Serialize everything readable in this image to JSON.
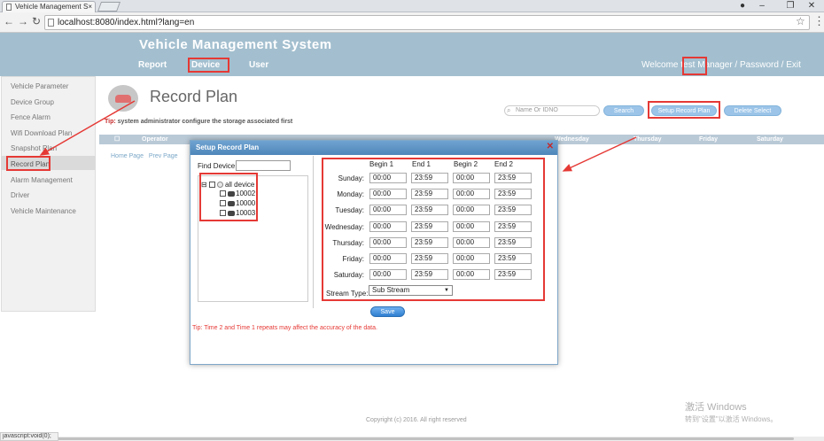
{
  "browser": {
    "tab_title": "Vehicle Management S",
    "url": "localhost:8080/index.html?lang=en"
  },
  "header": {
    "app_title": "Vehicle Management System",
    "nav": [
      "Report",
      "Device",
      "User"
    ],
    "welcome": "Welcome",
    "user": "test",
    "links": "Manager /  Password /  Exit"
  },
  "sidebar": {
    "items": [
      "Vehicle Parameter",
      "Device Group",
      "Fence Alarm",
      "Wifi Download Plan",
      "Snapshot Plan",
      "Record Plan",
      "Alarm Management",
      "Driver",
      "Vehicle Maintenance"
    ],
    "active": "Record Plan"
  },
  "main": {
    "page_title": "Record Plan",
    "tip_label": "Tip:",
    "tip": " system administrator configure the storage associated first",
    "search_placeholder": "Name Or IDNO",
    "search_btn": "Search",
    "setup_btn": "Setup Record Plan",
    "delete_btn": "Delete Select",
    "table_headers": [
      "Operator",
      "Wednesday",
      "Thursday",
      "Friday",
      "Saturday"
    ],
    "pager": [
      "Home Page",
      "Prev Page"
    ],
    "copyright": "Copyright (c) 2016. All right reserved"
  },
  "dialog": {
    "title": "Setup Record Plan",
    "find_label": "Find Device:",
    "tree": {
      "root": "all device",
      "devices": [
        "10002",
        "10000",
        "10003"
      ]
    },
    "columns": [
      "Begin 1",
      "End 1",
      "Begin 2",
      "End 2"
    ],
    "rows": [
      {
        "day": "Sunday:",
        "b1": "00:00",
        "e1": "23:59",
        "b2": "00:00",
        "e2": "23:59"
      },
      {
        "day": "Monday:",
        "b1": "00:00",
        "e1": "23:59",
        "b2": "00:00",
        "e2": "23:59"
      },
      {
        "day": "Tuesday:",
        "b1": "00:00",
        "e1": "23:59",
        "b2": "00:00",
        "e2": "23:59"
      },
      {
        "day": "Wednesday:",
        "b1": "00:00",
        "e1": "23:59",
        "b2": "00:00",
        "e2": "23:59"
      },
      {
        "day": "Thursday:",
        "b1": "00:00",
        "e1": "23:59",
        "b2": "00:00",
        "e2": "23:59"
      },
      {
        "day": "Friday:",
        "b1": "00:00",
        "e1": "23:59",
        "b2": "00:00",
        "e2": "23:59"
      },
      {
        "day": "Saturday:",
        "b1": "00:00",
        "e1": "23:59",
        "b2": "00:00",
        "e2": "23:59"
      }
    ],
    "stream_label": "Stream Type:",
    "stream_value": "Sub Stream",
    "save": "Save",
    "tip": "Tip: Time 2 and Time 1 repeats may affect the accuracy of the data."
  },
  "windows": {
    "line1": "激活 Windows",
    "line2": "转到\"设置\"以激活 Windows。"
  },
  "status_text": "javascript:void(0);",
  "colors": {
    "header_bg": "#a3bfcf",
    "accent_red": "#e53935",
    "button_blue": "#9bc4e8"
  }
}
